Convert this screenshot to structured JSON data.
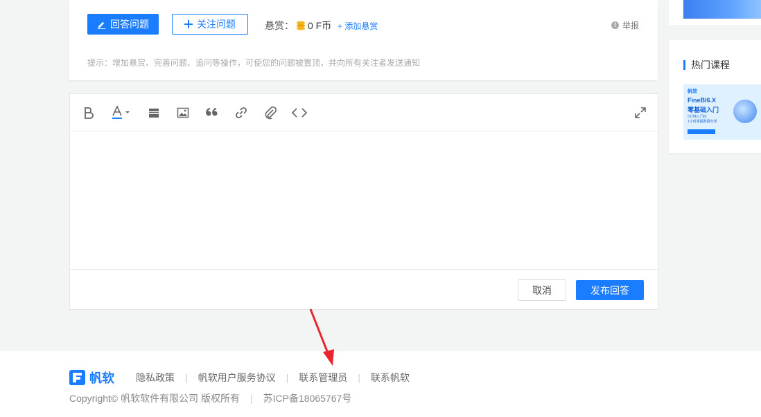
{
  "question_actions": {
    "answer_label": "回答问题",
    "follow_label": "关注问题",
    "bounty_label": "悬赏：",
    "bounty_amount": "0 F币",
    "add_bounty_label": "+ 添加悬赏",
    "report_label": "举报",
    "hint": "提示：增加悬赏、完善问题、追问等操作，可使您的问题被置顶，并向所有关注者发送通知"
  },
  "editor": {
    "toolbar_icons": [
      "bold-icon",
      "font-color-icon",
      "divider-icon",
      "image-icon",
      "quote-icon",
      "link-icon",
      "attachment-icon",
      "code-icon",
      "fullscreen-icon"
    ],
    "content": "",
    "cancel_label": "取消",
    "publish_label": "发布回答"
  },
  "sidebar": {
    "hot_courses_title": "热门课程",
    "course": {
      "logo": "帆软",
      "title_line1": "FineBI6.X",
      "title_line2": "零基础入门",
      "subtitle": "5分钟入门BI\n1小时掌握数据分析"
    }
  },
  "footer": {
    "logo_text": "帆软",
    "links": [
      "隐私政策",
      "帆软用户服务协议",
      "联系管理员",
      "联系帆软"
    ],
    "copyright": "Copyright© 帆软软件有限公司 版权所有",
    "icp": "苏ICP备18065767号"
  },
  "colors": {
    "primary": "#1a7dff",
    "annotation_arrow": "#e8262b"
  }
}
